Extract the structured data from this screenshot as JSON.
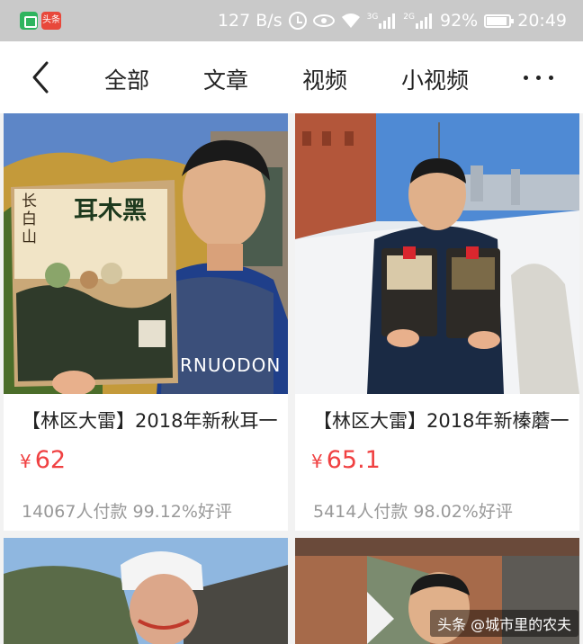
{
  "status_bar": {
    "app_badge": "头条",
    "net_speed": "127 B/s",
    "sig1_label": "3G",
    "sig2_label": "2G",
    "battery": "92%",
    "time": "20:49"
  },
  "nav": {
    "tabs": [
      "全部",
      "文章",
      "视频",
      "小视频"
    ]
  },
  "products": [
    {
      "title": "【林区大雷】2018年新秋耳一",
      "currency": "¥",
      "price": "62",
      "meta": "14067人付款 99.12%好评",
      "bag_text": "耳木黑",
      "bag_side": "长白山",
      "shirt_text": "RNUODON"
    },
    {
      "title": "【林区大雷】2018年新榛蘑一",
      "currency": "¥",
      "price": "65.1",
      "meta": "5414人付款 98.02%好评"
    }
  ],
  "watermark": "头条 @城市里的农夫",
  "colors": {
    "price": "#f04142",
    "status_bar": "#c9c9c9",
    "meta_text": "#999999"
  }
}
